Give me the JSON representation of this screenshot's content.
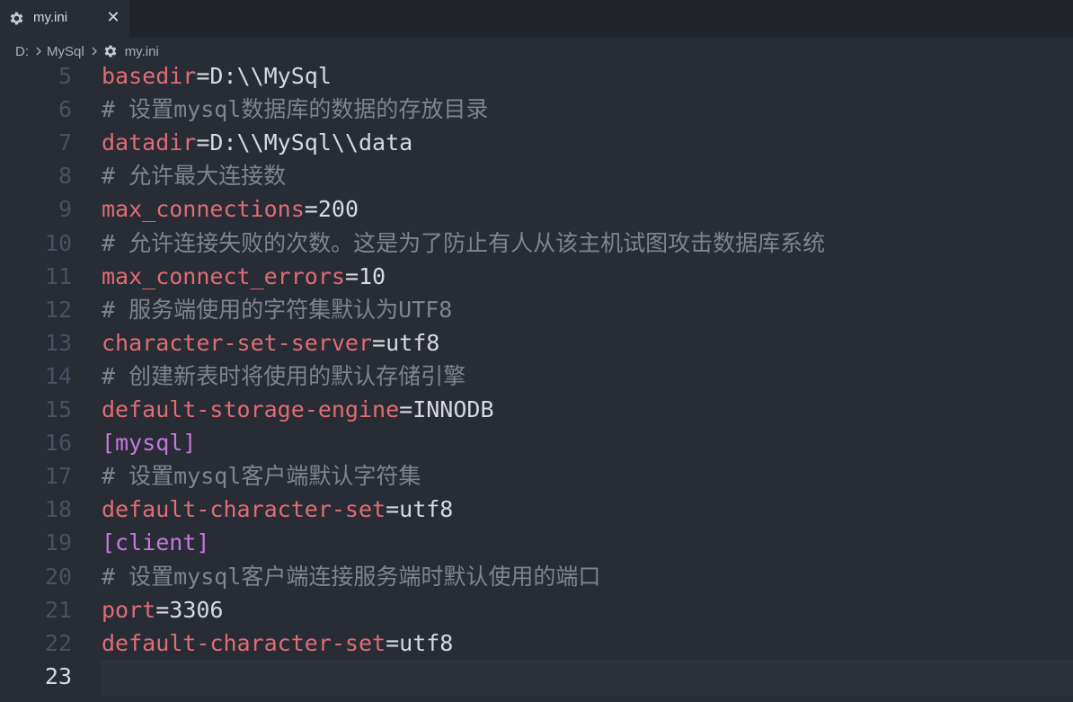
{
  "tab": {
    "title": "my.ini",
    "icon": "gear-icon",
    "close_label": "✕"
  },
  "breadcrumb": {
    "items": [
      "D:",
      "MySql",
      "my.ini"
    ]
  },
  "colors": {
    "key": "#e06c75",
    "comment": "#7f848e",
    "section": "#c678dd",
    "text": "#d7dae0",
    "line_number": "#495162",
    "background": "#282c34"
  },
  "editor": {
    "current_line": "23",
    "lines": [
      {
        "n": "5",
        "type": "kv",
        "key": "basedir",
        "value": "D:\\\\MySql"
      },
      {
        "n": "6",
        "type": "comment",
        "text": "# 设置mysql数据库的数据的存放目录"
      },
      {
        "n": "7",
        "type": "kv",
        "key": "datadir",
        "value": "D:\\\\MySql\\\\data"
      },
      {
        "n": "8",
        "type": "comment",
        "text": "# 允许最大连接数"
      },
      {
        "n": "9",
        "type": "kv",
        "key": "max_connections",
        "value": "200"
      },
      {
        "n": "10",
        "type": "comment",
        "text": "# 允许连接失败的次数。这是为了防止有人从该主机试图攻击数据库系统"
      },
      {
        "n": "11",
        "type": "kv",
        "key": "max_connect_errors",
        "value": "10"
      },
      {
        "n": "12",
        "type": "comment",
        "text": "# 服务端使用的字符集默认为UTF8"
      },
      {
        "n": "13",
        "type": "kv",
        "key": "character-set-server",
        "value": "utf8"
      },
      {
        "n": "14",
        "type": "comment",
        "text": "# 创建新表时将使用的默认存储引擎"
      },
      {
        "n": "15",
        "type": "kv",
        "key": "default-storage-engine",
        "value": "INNODB"
      },
      {
        "n": "16",
        "type": "section",
        "text": "[mysql]"
      },
      {
        "n": "17",
        "type": "comment",
        "text": "# 设置mysql客户端默认字符集"
      },
      {
        "n": "18",
        "type": "kv",
        "key": "default-character-set",
        "value": "utf8"
      },
      {
        "n": "19",
        "type": "section",
        "text": "[client]"
      },
      {
        "n": "20",
        "type": "comment",
        "text": "# 设置mysql客户端连接服务端时默认使用的端口"
      },
      {
        "n": "21",
        "type": "kv",
        "key": "port",
        "value": "3306"
      },
      {
        "n": "22",
        "type": "kv",
        "key": "default-character-set",
        "value": "utf8"
      },
      {
        "n": "23",
        "type": "empty",
        "text": ""
      }
    ]
  }
}
